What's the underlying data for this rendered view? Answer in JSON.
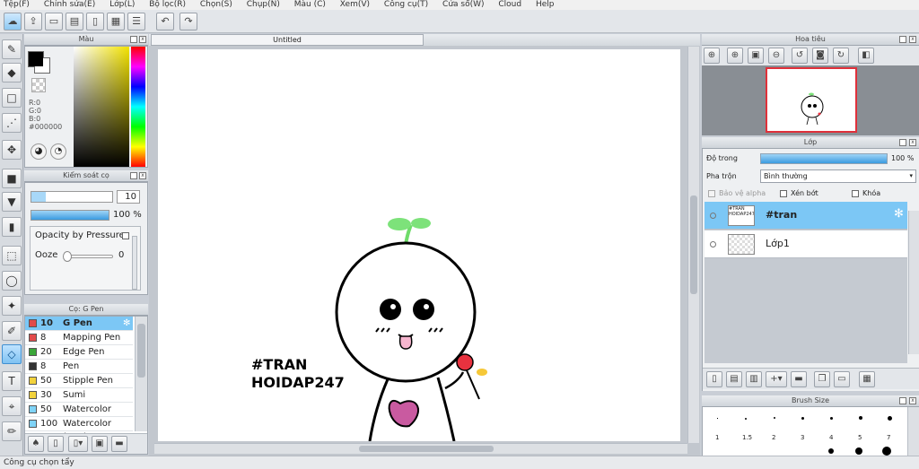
{
  "menu": [
    "Tệp(F)",
    "Chỉnh sửa(E)",
    "Lớp(L)",
    "Bộ lọc(R)",
    "Chọn(S)",
    "Chụp(N)",
    "Màu (C)",
    "Xem(V)",
    "Công cụ(T)",
    "Cửa sổ(W)",
    "Cloud",
    "Help"
  ],
  "panels": {
    "color_title": "Màu",
    "brush_control_title": "Kiểm soát cọ",
    "brush_list_title": "Cọ: G Pen",
    "navigator_title": "Hoa tiêu",
    "layer_title": "Lớp",
    "brush_size_title": "Brush Size"
  },
  "color": {
    "r": "R:0",
    "g": "G:0",
    "b": "B:0",
    "hex": "#000000",
    "primary": "#000000",
    "secondary": "#ffffff"
  },
  "brush_control": {
    "size": "10",
    "opacity": "100 %",
    "opacity_fill": 1.0,
    "pressure_label": "Opacity by Pressure",
    "ooze_label": "Ooze",
    "ooze_value": "0"
  },
  "brushes": [
    {
      "size": "10",
      "name": "G Pen",
      "color": "#e24b4b",
      "selected": true
    },
    {
      "size": "8",
      "name": "Mapping Pen",
      "color": "#e24b4b",
      "selected": false
    },
    {
      "size": "20",
      "name": "Edge Pen",
      "color": "#3aa639",
      "selected": false
    },
    {
      "size": "8",
      "name": "Pen",
      "color": "#333333",
      "selected": false
    },
    {
      "size": "50",
      "name": "Stipple Pen",
      "color": "#f2d23c",
      "selected": false
    },
    {
      "size": "30",
      "name": "Sumi",
      "color": "#f2d23c",
      "selected": false
    },
    {
      "size": "50",
      "name": "Watercolor",
      "color": "#7fd3f7",
      "selected": false
    },
    {
      "size": "100",
      "name": "Watercolor (Wet)",
      "color": "#7fd3f7",
      "selected": false
    }
  ],
  "canvas": {
    "tab_title": "Untitled",
    "drawing_text_line1": "#TRAN",
    "drawing_text_line2": "HOIDAP247"
  },
  "layer_panel": {
    "opacity_label": "Độ trong",
    "opacity_value": "100 %",
    "blend_label": "Pha trộn",
    "blend_value": "Bình thường",
    "protect_alpha": "Bảo vệ alpha",
    "clipping": "Xén bớt",
    "lock": "Khóa",
    "layers": [
      {
        "name": "#tran",
        "thumb_text": "#TRAN HOIDAP247",
        "selected": true
      },
      {
        "name": "Lớp1",
        "thumb_text": "",
        "selected": false
      }
    ]
  },
  "brush_sizes": [
    "1",
    "1.5",
    "2",
    "3",
    "4",
    "5",
    "7"
  ],
  "status": "Công cụ chọn tẩy",
  "accent": "#7cc7f5"
}
